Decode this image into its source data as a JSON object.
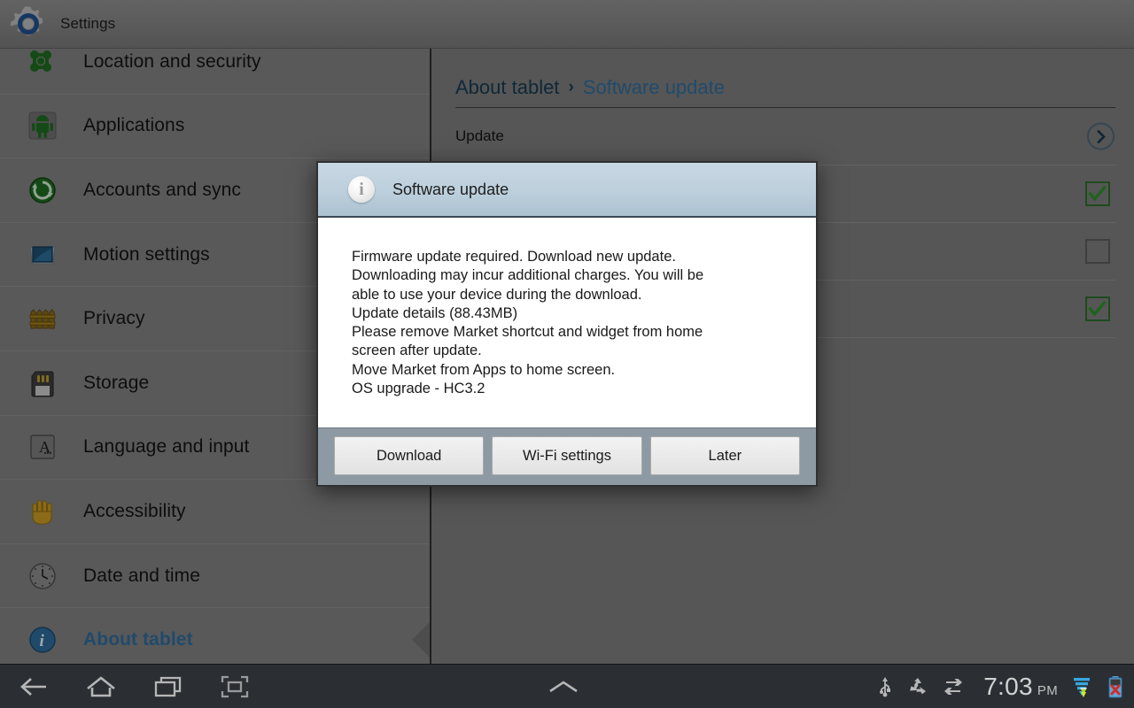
{
  "actionbar": {
    "title": "Settings",
    "icon": "settings-gear-icon"
  },
  "sidebar": {
    "items": [
      {
        "label": "Location and security",
        "icon": "location-security-icon",
        "selected": false,
        "clipped": true
      },
      {
        "label": "Applications",
        "icon": "applications-android-icon",
        "selected": false
      },
      {
        "label": "Accounts and sync",
        "icon": "accounts-sync-icon",
        "selected": false
      },
      {
        "label": "Motion settings",
        "icon": "motion-settings-icon",
        "selected": false
      },
      {
        "label": "Privacy",
        "icon": "privacy-fence-icon",
        "selected": false
      },
      {
        "label": "Storage",
        "icon": "storage-sdcard-icon",
        "selected": false
      },
      {
        "label": "Language and input",
        "icon": "language-input-icon",
        "selected": false
      },
      {
        "label": "Accessibility",
        "icon": "accessibility-hand-icon",
        "selected": false
      },
      {
        "label": "Date and time",
        "icon": "date-time-clock-icon",
        "selected": false
      },
      {
        "label": "About tablet",
        "icon": "about-tablet-info-icon",
        "selected": true
      }
    ]
  },
  "content": {
    "breadcrumb": {
      "root": "About tablet",
      "separator": "›",
      "current": "Software update"
    },
    "rows": [
      {
        "label": "Update",
        "control": "chevron",
        "checked": null
      },
      {
        "label": "",
        "control": "checkbox",
        "checked": true
      },
      {
        "label": "",
        "control": "checkbox",
        "checked": false
      },
      {
        "label": "",
        "control": "checkbox",
        "checked": true
      }
    ]
  },
  "dialog": {
    "icon": "info-icon",
    "title": "Software update",
    "message_lines": [
      "Firmware update required. Download new update.",
      "Downloading may incur additional charges. You will be",
      "able to use your device during the download.",
      "Update details (88.43MB)",
      "Please remove Market shortcut and widget from home",
      "screen after update.",
      "Move Market from Apps to home screen.",
      "OS upgrade - HC3.2"
    ],
    "update_size": "88.43MB",
    "os_version": "HC3.2",
    "buttons": [
      {
        "label": "Download",
        "name": "download-button"
      },
      {
        "label": "Wi-Fi settings",
        "name": "wifi-settings-button"
      },
      {
        "label": "Later",
        "name": "later-button"
      }
    ]
  },
  "systembar": {
    "nav": [
      {
        "name": "back-icon"
      },
      {
        "name": "home-icon"
      },
      {
        "name": "recent-apps-icon"
      },
      {
        "name": "screenshot-icon"
      }
    ],
    "menu": {
      "name": "chevron-up-icon"
    },
    "status": [
      {
        "name": "usb-icon"
      },
      {
        "name": "recycle-icon"
      },
      {
        "name": "sync-icon"
      }
    ],
    "time": "7:03",
    "ampm": "PM",
    "signal_icon": "signal-download-icon",
    "battery_icon": "battery-error-icon"
  },
  "colors": {
    "accent_blue": "#2f6b9a",
    "checkbox_green": "#2d6b2d",
    "dialog_header": "#bccfdc",
    "sidebar_bg": "#808080",
    "sysbar_bg": "#2b2f33"
  }
}
